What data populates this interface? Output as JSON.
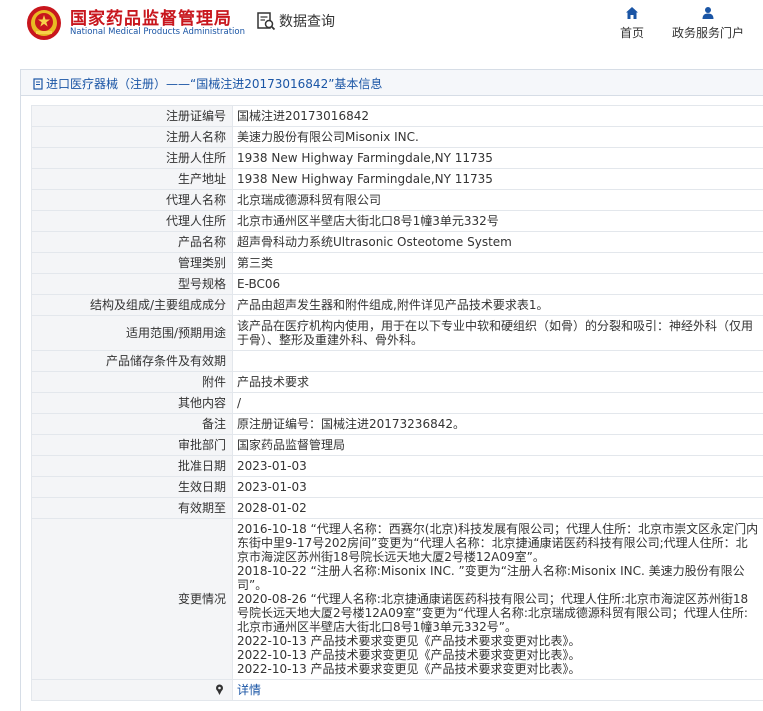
{
  "header": {
    "brand_cn": "国家药品监督管理局",
    "brand_en": "National Medical Products Administration",
    "data_query": "数据查询",
    "nav": {
      "home": "首页",
      "portal": "政务服务门户"
    },
    "colors": {
      "brand_red": "#c8161d",
      "link_blue": "#1a55a5"
    }
  },
  "panel": {
    "title": "进口医疗器械（注册）——“国械注进20173016842”基本信息"
  },
  "rows": [
    {
      "label": "注册证编号",
      "value": "国械注进20173016842"
    },
    {
      "label": "注册人名称",
      "value": "美速力股份有限公司Misonix INC."
    },
    {
      "label": "注册人住所",
      "value": "1938 New Highway Farmingdale,NY 11735"
    },
    {
      "label": "生产地址",
      "value": "1938 New Highway Farmingdale,NY 11735"
    },
    {
      "label": "代理人名称",
      "value": "北京瑞成德源科贸有限公司"
    },
    {
      "label": "代理人住所",
      "value": "北京市通州区半壁店大街北口8号1幢3单元332号"
    },
    {
      "label": "产品名称",
      "value": "超声骨科动力系统Ultrasonic Osteotome System"
    },
    {
      "label": "管理类别",
      "value": "第三类"
    },
    {
      "label": "型号规格",
      "value": "E-BC06"
    },
    {
      "label": "结构及组成/主要组成成分",
      "value": "产品由超声发生器和附件组成,附件详见产品技术要求表1。"
    },
    {
      "label": "适用范围/预期用途",
      "value": "该产品在医疗机构内使用，用于在以下专业中软和硬组织（如骨）的分裂和吸引：神经外科（仅用于骨）、整形及重建外科、骨外科。"
    },
    {
      "label": "产品储存条件及有效期",
      "value": ""
    },
    {
      "label": "附件",
      "value": "产品技术要求"
    },
    {
      "label": "其他内容",
      "value": "/"
    },
    {
      "label": "备注",
      "value": "原注册证编号：国械注进20173236842。"
    },
    {
      "label": "审批部门",
      "value": "国家药品监督管理局"
    },
    {
      "label": "批准日期",
      "value": "2023-01-03"
    },
    {
      "label": "生效日期",
      "value": "2023-01-03"
    },
    {
      "label": "有效期至",
      "value": "2028-01-02"
    }
  ],
  "changes": {
    "label": "变更情况",
    "entries": [
      "2016-10-18 “代理人名称：西赛尔(北京)科技发展有限公司；代理人住所：北京市崇文区永定门内东街中里9-17号202房间”变更为“代理人名称：北京捷通康诺医药科技有限公司;代理人住所：北京市海淀区苏州街18号院长远天地大厦2号楼12A09室”。",
      "2018-10-22 “注册人名称:Misonix INC. ”变更为“注册人名称:Misonix INC. 美速力股份有限公司”。",
      "2020-08-26 “代理人名称:北京捷通康诺医药科技有限公司；代理人住所:北京市海淀区苏州街18号院长远天地大厦2号楼12A09室”变更为“代理人名称:北京瑞成德源科贸有限公司；代理人住所:北京市通州区半壁店大街北口8号1幢3单元332号”。",
      "2022-10-13 产品技术要求变更见《产品技术要求变更对比表》。",
      "2022-10-13 产品技术要求变更见《产品技术要求变更对比表》。",
      "2022-10-13 产品技术要求变更见《产品技术要求变更对比表》。"
    ]
  },
  "details": {
    "icon": "pin-icon",
    "link_label": "详情"
  }
}
